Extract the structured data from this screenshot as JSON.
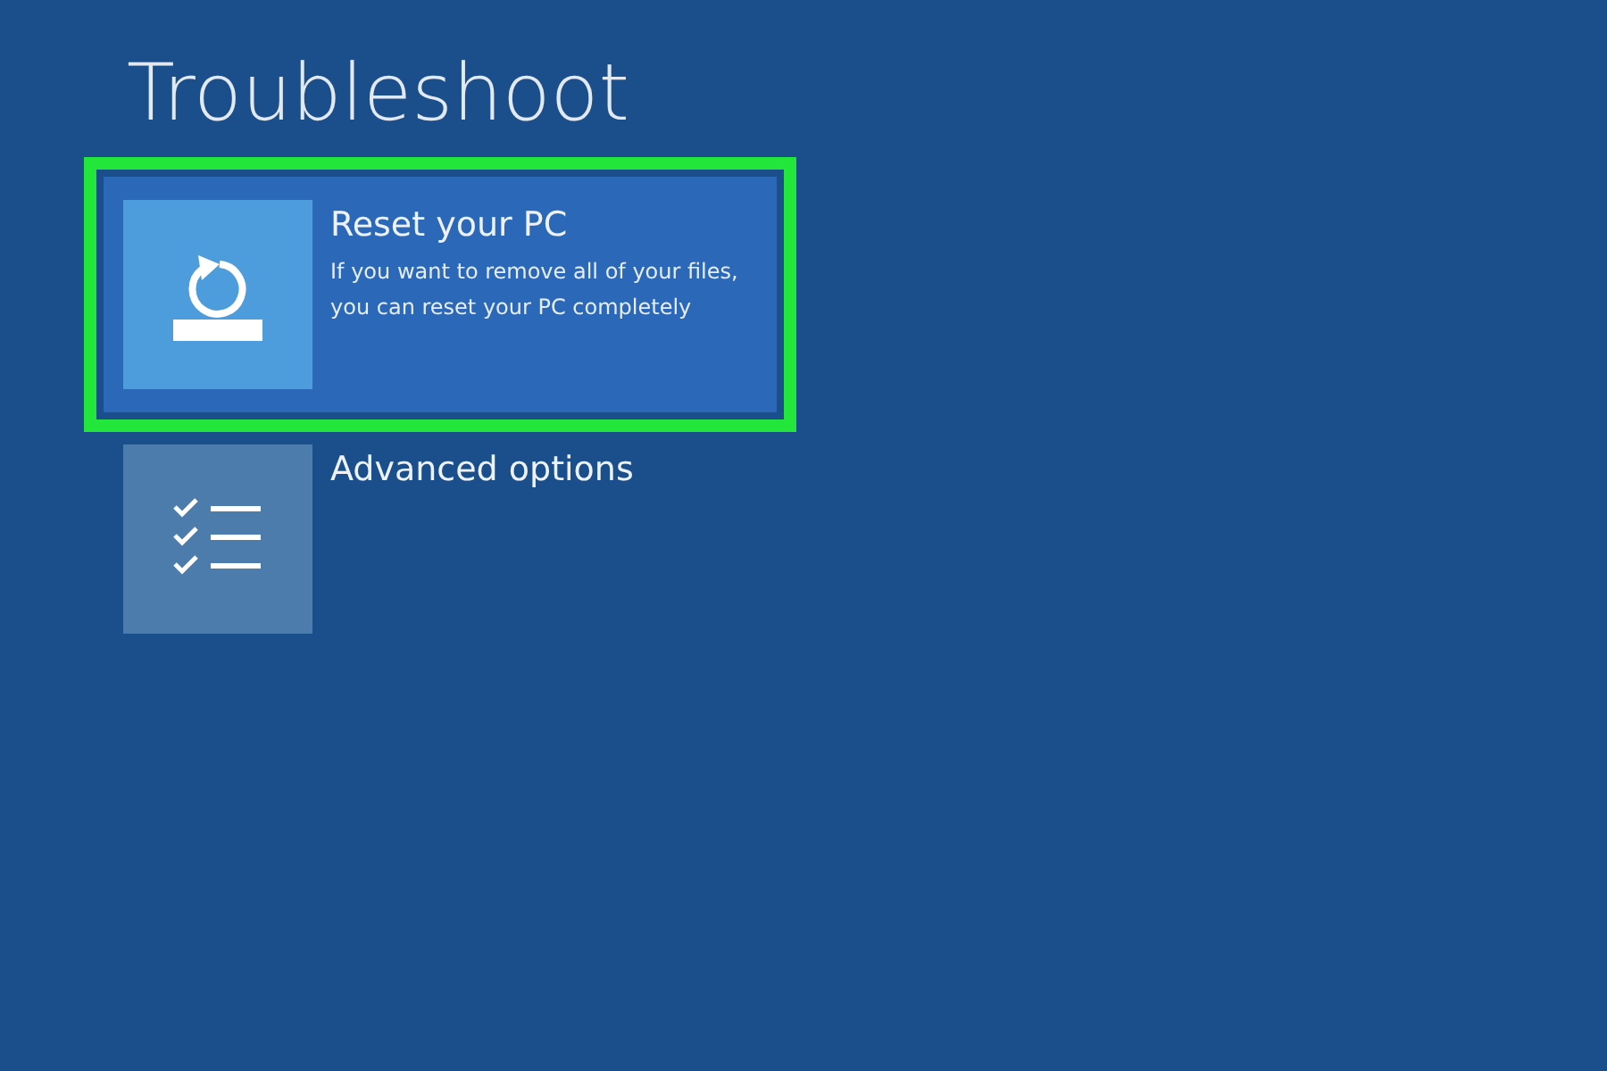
{
  "title": "Troubleshoot",
  "options": [
    {
      "kind": "reset",
      "title": "Reset your PC",
      "description": "If you want to remove all of your files, you can reset your PC completely",
      "selected": true,
      "highlighted": true
    },
    {
      "kind": "advanced",
      "title": "Advanced options",
      "selected": false,
      "highlighted": false
    }
  ]
}
